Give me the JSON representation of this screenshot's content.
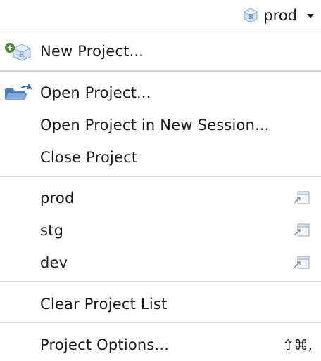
{
  "toolbar": {
    "project_name": "prod",
    "project_icon": "rproj-cube-icon",
    "dropdown_icon": "caret-down-icon"
  },
  "menu": {
    "new_project": {
      "label": "New Project...",
      "icon": "new-project-icon"
    },
    "open_project": {
      "label": "Open Project...",
      "icon": "open-folder-icon"
    },
    "open_project_new_session": {
      "label": "Open Project in New Session..."
    },
    "close_project": {
      "label": "Close Project"
    },
    "recent_projects": [
      {
        "label": "prod",
        "icon": "open-in-new-session-icon"
      },
      {
        "label": "stg",
        "icon": "open-in-new-session-icon"
      },
      {
        "label": "dev",
        "icon": "open-in-new-session-icon"
      }
    ],
    "clear_project_list": {
      "label": "Clear Project List"
    },
    "project_options": {
      "label": "Project Options...",
      "shortcut": "⇧⌘,"
    }
  },
  "colors": {
    "separator": "#cfcfcf",
    "icon_blue": "#5a8fc9",
    "text": "#1a1a1a"
  }
}
